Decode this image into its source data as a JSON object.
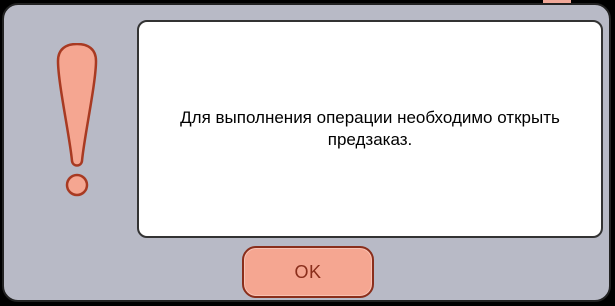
{
  "dialog": {
    "message": "Для выполнения операции необходимо открыть предзаказ.",
    "ok_label": "OK",
    "icon": "exclamation-warning-icon"
  },
  "colors": {
    "dialog_background": "#b8bac6",
    "message_background": "#ffffff",
    "button_fill": "#f5a691",
    "button_border": "#8a2e1b",
    "icon_fill": "#f5a691",
    "icon_stroke": "#a83a22"
  }
}
